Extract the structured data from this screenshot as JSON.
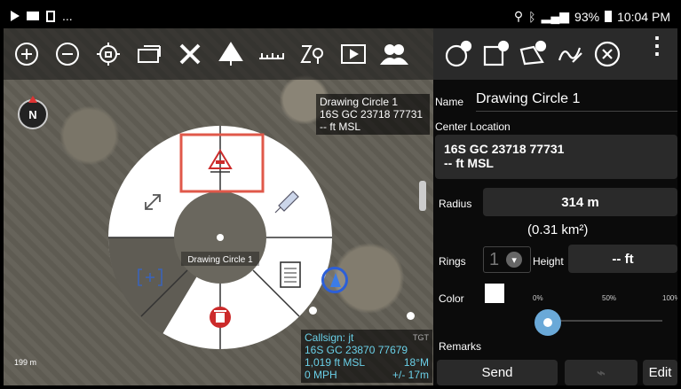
{
  "status": {
    "left_text": "...",
    "battery": "93%",
    "time": "10:04 PM"
  },
  "map": {
    "compass_label": "N",
    "drawing_info": {
      "line1": "Drawing Circle 1",
      "line2": "16S GC 23718 77731",
      "line3": "-- ft MSL"
    },
    "callsign_info": {
      "line1": "Callsign: jt",
      "tag": "TGT",
      "line2": "16S  GC 23870  77679",
      "line3_left": "1,019 ft MSL",
      "line3_right": "18°M",
      "line4_left": "0 MPH",
      "line4_right": "+/- 17m"
    },
    "radial_center_label": "Drawing Circle 1",
    "scale_label": "199 m"
  },
  "panel": {
    "name_label": "Name",
    "name_value": "Drawing Circle 1",
    "center_label": "Center Location",
    "center_line1": "16S GC 23718 77731",
    "center_line2": "-- ft MSL",
    "radius_label": "Radius",
    "radius_value": "314 m",
    "area_value": "(0.31 km²)",
    "rings_label": "Rings",
    "rings_value": "1",
    "height_label": "Height",
    "height_value": "-- ft",
    "color_label": "Color",
    "opacity_marks": [
      "0%",
      "50%",
      "100%"
    ],
    "remarks_label": "Remarks",
    "send_label": "Send",
    "edit_label": "Edit"
  },
  "colors": {
    "highlight": "#e0584a",
    "accent": "#6aa9d8",
    "delete_red": "#cc2b2b"
  }
}
